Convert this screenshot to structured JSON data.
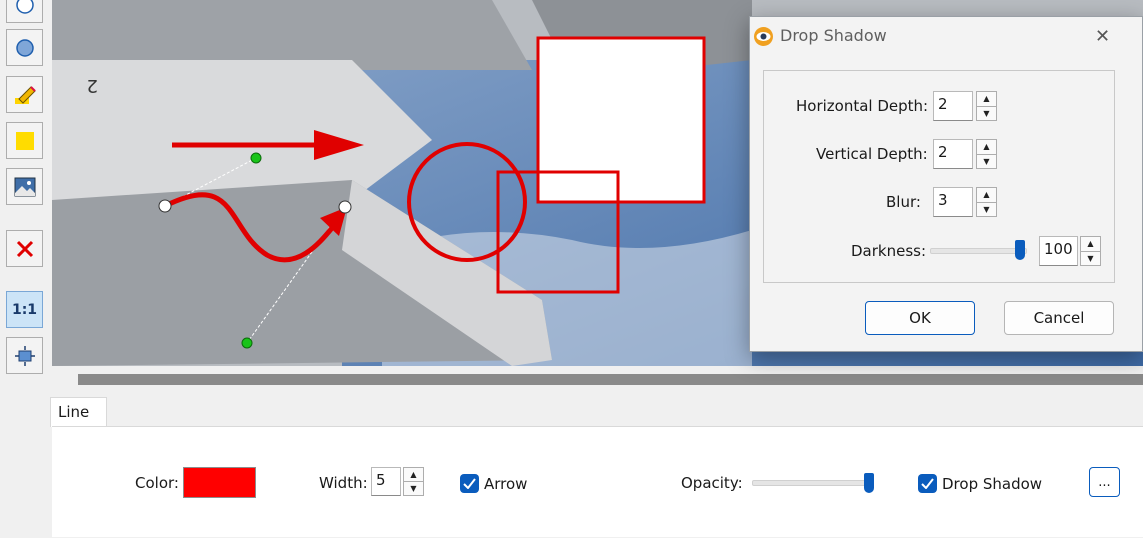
{
  "toolbar": {
    "tools": [
      {
        "icon": "ellipse-outline-icon"
      },
      {
        "icon": "ellipse-filled-icon"
      },
      {
        "icon": "highlighter-icon"
      },
      {
        "icon": "filled-rectangle-icon"
      },
      {
        "icon": "image-icon"
      },
      {
        "icon": "delete-icon"
      },
      {
        "icon": "actual-size-icon",
        "label": "1:1"
      },
      {
        "icon": "fit-to-window-icon"
      }
    ]
  },
  "panel": {
    "tab_label": "Line",
    "color_label": "Color:",
    "color_value": "#ff0000",
    "width_label": "Width:",
    "width_value": "5",
    "arrow_label": "Arrow",
    "arrow_checked": true,
    "opacity_label": "Opacity:",
    "opacity_level": 1.0,
    "drop_shadow_label": "Drop Shadow",
    "drop_shadow_checked": true,
    "more_label": "..."
  },
  "dialog": {
    "title": "Drop Shadow",
    "horizontal_depth_label": "Horizontal Depth:",
    "horizontal_depth_value": "2",
    "vertical_depth_label": "Vertical Depth:",
    "vertical_depth_value": "2",
    "blur_label": "Blur:",
    "blur_value": "3",
    "darkness_label": "Darkness:",
    "darkness_value": "100",
    "ok_label": "OK",
    "cancel_label": "Cancel"
  },
  "colors": {
    "accent": "#0a5cbd",
    "annotation_red": "#e00000",
    "handle_green": "#19c419"
  }
}
